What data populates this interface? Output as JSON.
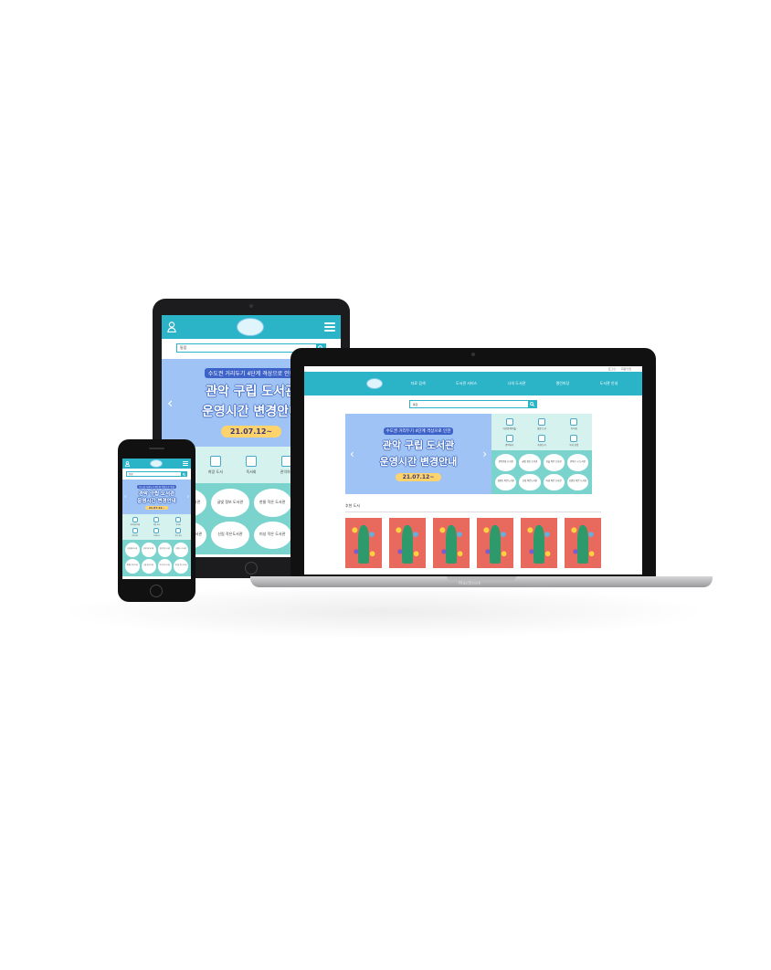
{
  "header": {
    "logo_label": "",
    "search_select": "통합"
  },
  "desktop_nav": [
    "자료 검색",
    "도서관 서비스",
    "나의 도서관",
    "열린마당",
    "도서관 안내"
  ],
  "desktop_util": [
    "로그인",
    "회원가입"
  ],
  "banner": {
    "notice": "수도권 거리두기 4단계 격상으로 인한",
    "line1": "관악 구립 도서관",
    "line2": "운영시간 변경안내",
    "date": "21.07.12~",
    "prev": "‹",
    "next": "›"
  },
  "tablet_quick": [
    "자료검색",
    "희망 도서",
    "독서회",
    "관악하다",
    "추천 도서"
  ],
  "desktop_quick": [
    "자료검색/대출",
    "희망 도서",
    "독서회",
    "관악하다",
    "추천도서",
    "독서 모임"
  ],
  "libraries": [
    "관악문화 도서관",
    "글빛 정보 도서관",
    "한울 작은 도서관",
    "관악산 시 도서관",
    "청룡동 작은도서관",
    "신림 작은도서관",
    "미성 작은 도서관",
    "조원동 작은 도서관"
  ],
  "section": {
    "recommend": "추천 도서"
  },
  "device": {
    "laptop_brand": "MacBook"
  },
  "colors": {
    "primary": "#2bb3c8",
    "banner": "#9ec3f4",
    "notice": "#3d63c9",
    "date_pill": "#ffd36b",
    "mint": "#7ad4cd"
  }
}
